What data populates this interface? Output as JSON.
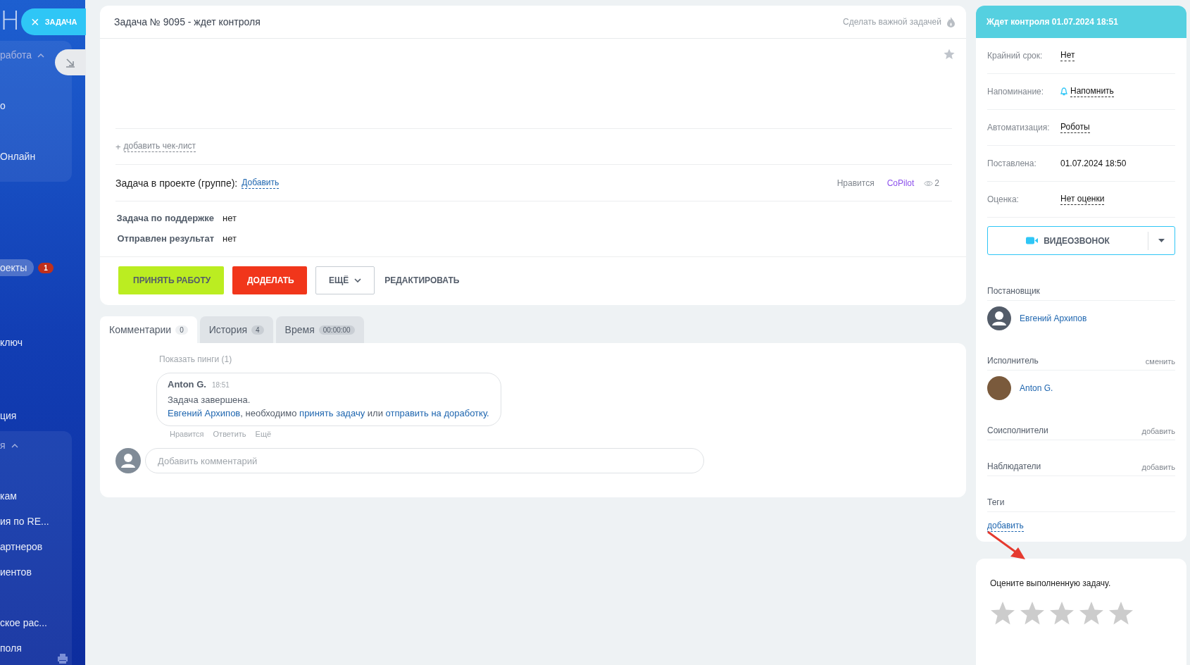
{
  "sidebar": {
    "logo": "Н",
    "close_chip": {
      "icon": "×",
      "label": "ЗАДАЧА"
    },
    "items": [
      {
        "label": "работа",
        "kind": "group",
        "expanded": true
      },
      {
        "label": "о",
        "kind": "item",
        "selected": false
      },
      {
        "label": "Онлайн",
        "kind": "item",
        "selected": false
      },
      {
        "label": "оекты",
        "kind": "item",
        "selected": true,
        "badge": "1"
      },
      {
        "label": "ключ",
        "kind": "item",
        "selected": false
      },
      {
        "label": "ция",
        "kind": "item",
        "selected": false
      },
      {
        "label": "я",
        "kind": "group",
        "expanded": true
      },
      {
        "label": "кам",
        "kind": "item",
        "selected": false
      },
      {
        "label": "ия по RE...",
        "kind": "item",
        "selected": false
      },
      {
        "label": "артнеров",
        "kind": "item",
        "selected": false
      },
      {
        "label": "иентов",
        "kind": "item",
        "selected": false
      },
      {
        "label": "ское рас...",
        "kind": "item",
        "selected": false
      },
      {
        "label": "поля",
        "kind": "item",
        "selected": false
      }
    ]
  },
  "task": {
    "title": "Задача № 9095 - ждет контроля",
    "important_link": "Сделать важной задачей",
    "favorite": false,
    "add_checklist": {
      "plus": "+",
      "label": "добавить чек-лист"
    },
    "project": {
      "label": "Задача в проекте (группе):",
      "link": "Добавить"
    },
    "like": "Нравится",
    "copilot": "CoPilot",
    "views": "2",
    "fields": [
      {
        "label": "Задача по поддержке",
        "value": "нет"
      },
      {
        "label": "Отправлен результат",
        "value": "нет"
      }
    ],
    "buttons": [
      {
        "label": "ПРИНЯТЬ РАБОТУ",
        "kind": "accept"
      },
      {
        "label": "ДОДЕЛАТЬ",
        "kind": "reject"
      },
      {
        "label": "ЕЩЁ",
        "kind": "more"
      },
      {
        "label": "РЕДАКТИРОВАТЬ",
        "kind": "link"
      }
    ]
  },
  "tabs": [
    {
      "label": "Комментарии",
      "count": "0",
      "selected": true
    },
    {
      "label": "История",
      "count": "4",
      "selected": false
    },
    {
      "label": "Время",
      "count": "00:00:00",
      "selected": false
    }
  ],
  "comments": {
    "show_pings": "Показать пинги (1)",
    "items": [
      {
        "author": "Anton G.",
        "time": "18:51",
        "line1": "Задача завершена.",
        "parts": [
          {
            "text": "Евгений Архипов",
            "link": true
          },
          {
            "text": ", необходимо ",
            "link": false
          },
          {
            "text": "принять задачу",
            "link": true
          },
          {
            "text": " или ",
            "link": false
          },
          {
            "text": "отправить на доработку.",
            "link": true
          }
        ],
        "actions": [
          "Нравится",
          "Ответить",
          "Ещё"
        ]
      }
    ],
    "input": {
      "placeholder": "Добавить комментарий"
    }
  },
  "status": {
    "title": "Ждет контроля 01.07.2024 18:51",
    "rows": [
      {
        "label": "Крайний срок:",
        "value": "Нет",
        "kind": "link"
      },
      {
        "label": "Напоминание:",
        "value": "Напомнить",
        "kind": "bell"
      },
      {
        "label": "Автоматизация:",
        "value": "Роботы",
        "kind": "link"
      },
      {
        "label": "Поставлена:",
        "value": "01.07.2024 18:50",
        "kind": "text"
      },
      {
        "label": "Оценка:",
        "value": "Нет оценки",
        "kind": "link"
      }
    ],
    "video_button": "ВИДЕОЗВОНОК",
    "people": [
      {
        "title": "Постановщик",
        "people": [
          {
            "name": "Евгений Архипов",
            "kind": "silhouette"
          }
        ]
      },
      {
        "title": "Исполнитель",
        "action": "сменить",
        "people": [
          {
            "name": "Anton G.",
            "kind": "photo"
          }
        ]
      },
      {
        "title": "Соисполнители",
        "action": "добавить"
      },
      {
        "title": "Наблюдатели",
        "action": "добавить"
      },
      {
        "title": "Теги",
        "link": "добавить"
      }
    ]
  },
  "rating": {
    "prompt": "Оцените выполненную задачу.",
    "stars": 0
  }
}
